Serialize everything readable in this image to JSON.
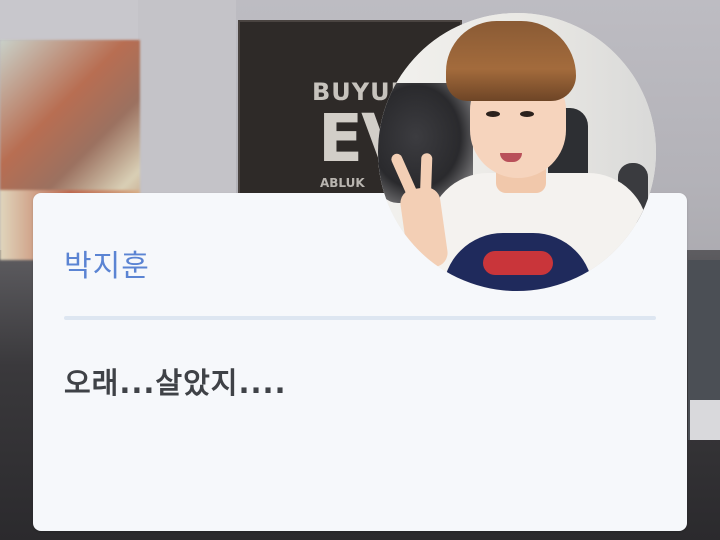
{
  "background": {
    "sign_line1": "BUYUK",
    "sign_line2": "EV",
    "sign_line3": "ABLUK"
  },
  "avatar": {
    "icon": "character-portrait"
  },
  "dialog": {
    "speaker_name": "박지훈",
    "message": "오래...살았지....",
    "speaker_color": "#5b84d3",
    "text_color": "#3f4247",
    "card_color": "#f6f8fb"
  }
}
